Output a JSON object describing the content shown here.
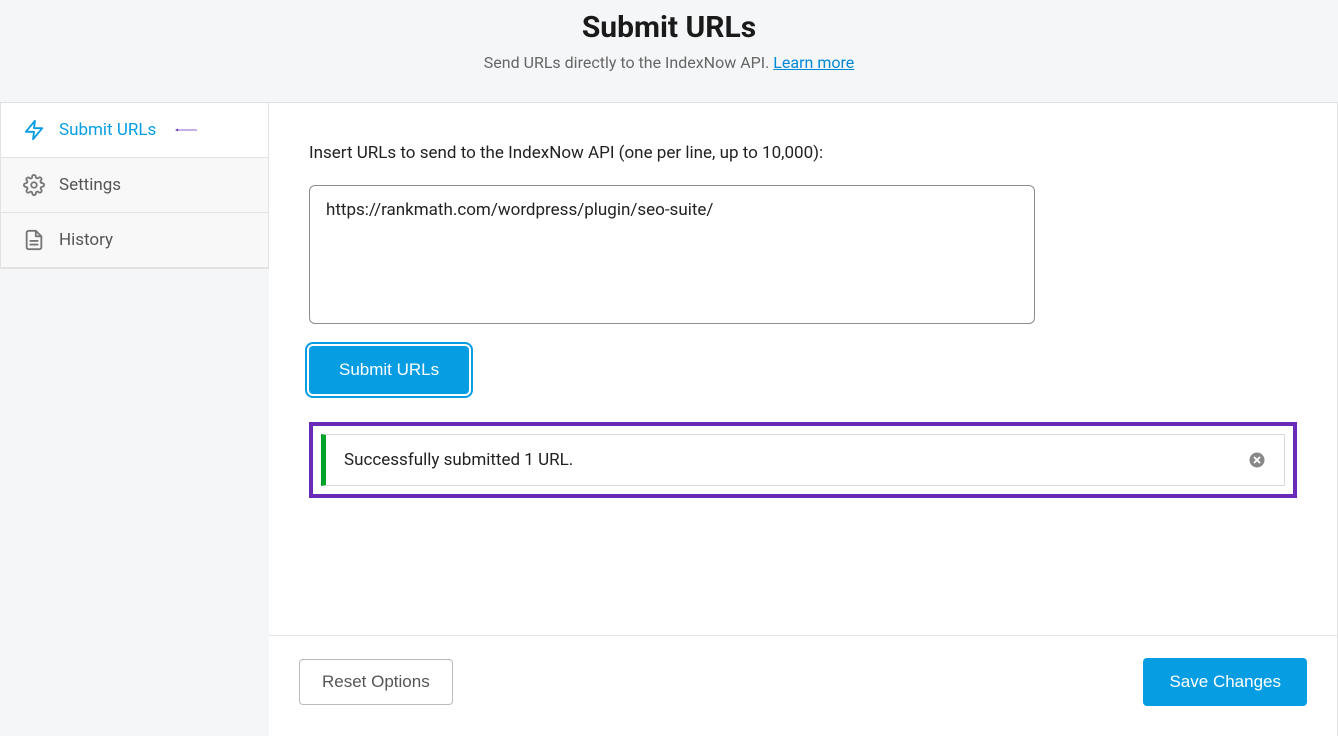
{
  "header": {
    "title": "Submit URLs",
    "subtitle_prefix": "Send URLs directly to the IndexNow API. ",
    "learn_more": "Learn more"
  },
  "sidebar": {
    "items": [
      {
        "label": "Submit URLs",
        "icon": "bolt-icon",
        "active": true
      },
      {
        "label": "Settings",
        "icon": "gear-icon",
        "active": false
      },
      {
        "label": "History",
        "icon": "file-icon",
        "active": false
      }
    ]
  },
  "main": {
    "field_label": "Insert URLs to send to the IndexNow API (one per line, up to 10,000):",
    "textarea_value": "https://rankmath.com/wordpress/plugin/seo-suite/",
    "submit_label": "Submit URLs",
    "notice_text": "Successfully submitted 1 URL."
  },
  "footer": {
    "reset_label": "Reset Options",
    "save_label": "Save Changes"
  },
  "annotation": {
    "arrow_color": "#6a2bb8"
  }
}
